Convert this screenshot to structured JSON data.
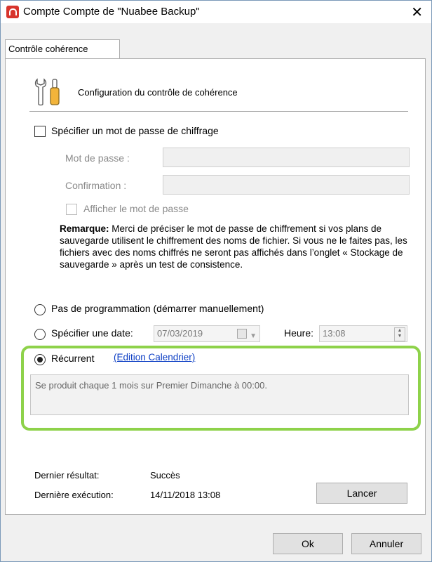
{
  "window": {
    "title": "Compte Compte de \"Nuabee Backup\""
  },
  "tabs": [
    {
      "label": "Contrôle cohérence"
    }
  ],
  "header": {
    "title": "Configuration du contrôle de cohérence"
  },
  "encryption": {
    "checkbox_label": "Spécifier un mot de passe de chiffrage",
    "checked": false,
    "password_label": "Mot de passe :",
    "password_value": "",
    "confirm_label": "Confirmation :",
    "confirm_value": "",
    "show_password_label": "Afficher le mot de passe"
  },
  "remark": {
    "title": "Remarque:",
    "text": "Merci de préciser le mot de passe de chiffrement si vos plans de sauvegarde utilisent le chiffrement des noms de fichier. Si vous ne le faites pas, les fichiers avec des noms chiffrés ne seront pas affichés dans l’onglet « Stockage de sauvegarde » après un test de consistence."
  },
  "schedule": {
    "manual_label": "Pas de programmation (démarrer manuellement)",
    "date_label": "Spécifier une date:",
    "date_value": "07/03/2019",
    "time_label": "Heure:",
    "time_value": "13:08",
    "recurrent_label": "Récurrent",
    "recurrent_selected": true,
    "edit_link": "(Edition Calendrier)",
    "recurrence_text": "Se produit chaque 1 mois sur Premier Dimanche à 00:00."
  },
  "status": {
    "last_result_label": "Dernier résultat:",
    "last_result_value": "Succès",
    "last_run_label": "Dernière exécution:",
    "last_run_value": "14/11/2018 13:08",
    "run_button": "Lancer"
  },
  "footer": {
    "ok_button": "Ok",
    "cancel_button": "Annuler"
  },
  "colors": {
    "highlight": "#8ed24a",
    "link": "#0a3cc4",
    "app_icon": "#d8342c"
  },
  "icons": {
    "app": "nuabee-logo-icon",
    "header": "wrench-screwdriver-icon",
    "close": "close-icon"
  }
}
